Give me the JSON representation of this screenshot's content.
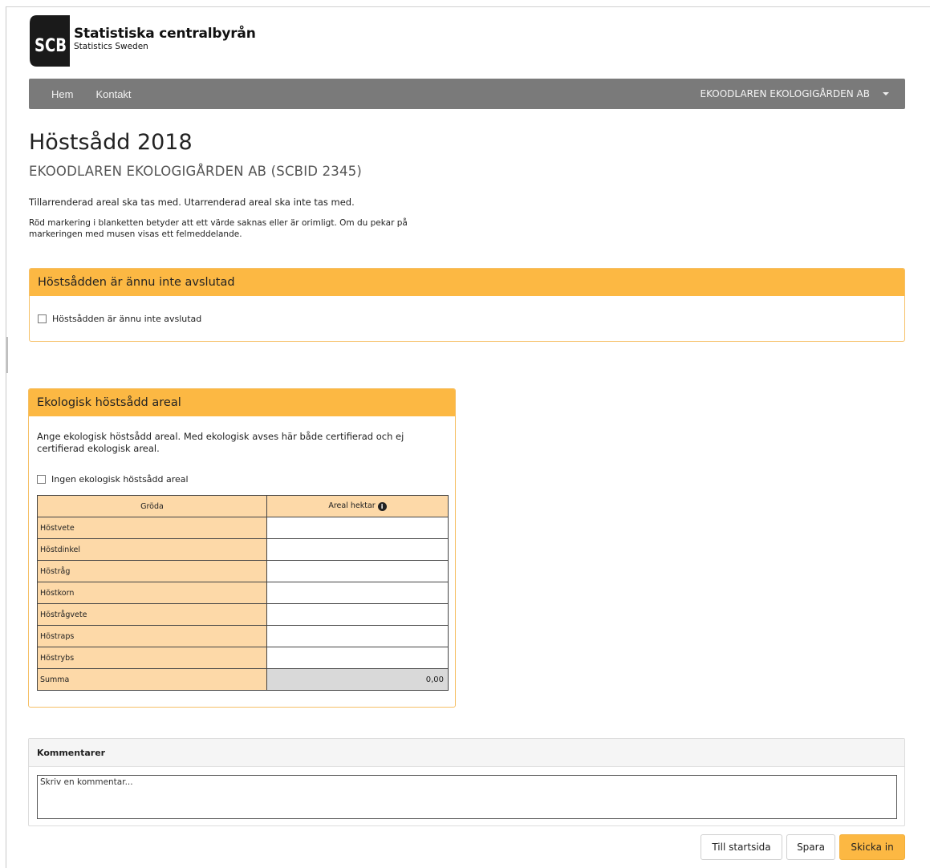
{
  "brand": {
    "mark_text": "SCB",
    "name": "Statistiska centralbyrån",
    "tagline": "Statistics Sweden"
  },
  "nav": {
    "links": [
      {
        "label": "Hem"
      },
      {
        "label": "Kontakt"
      }
    ],
    "user_menu_label": "EKOODLAREN EKOLOGIGÅRDEN AB"
  },
  "page": {
    "title": "Höstsådd 2018",
    "subtitle": "EKOODLAREN EKOLOGIGÅRDEN AB (SCBID 2345)",
    "intro_1": "Tillarrenderad areal ska tas med. Utarrenderad areal ska inte tas med.",
    "intro_2": "Röd markering i blanketten betyder att ett värde saknas eller är orimligt. Om du pekar på markeringen med musen visas ett felmeddelande."
  },
  "panel_unfinished": {
    "heading": "Höstsådden är ännu inte avslutad",
    "checkbox_label": "Höstsådden är ännu inte avslutad",
    "checked": false
  },
  "panel_organic": {
    "heading": "Ekologisk höstsådd areal",
    "description": "Ange ekologisk höstsådd areal. Med ekologisk avses här både certifierad och ej certifierad ekologisk areal.",
    "checkbox_label": "Ingen ekologisk höstsådd areal",
    "checked": false,
    "table": {
      "headers": {
        "crop": "Gröda",
        "area": "Areal hektar"
      },
      "rows": [
        {
          "crop": "Höstvete",
          "area": ""
        },
        {
          "crop": "Höstdinkel",
          "area": ""
        },
        {
          "crop": "Höstråg",
          "area": ""
        },
        {
          "crop": "Höstkorn",
          "area": ""
        },
        {
          "crop": "Höstrågvete",
          "area": ""
        },
        {
          "crop": "Höstraps",
          "area": ""
        },
        {
          "crop": "Höstrybs",
          "area": ""
        }
      ],
      "sum_label": "Summa",
      "sum_value": "0,00"
    }
  },
  "comments": {
    "heading": "Kommentarer",
    "placeholder": "Skriv en kommentar..."
  },
  "actions": {
    "home": "Till startsida",
    "save": "Spara",
    "submit": "Skicka in"
  },
  "colors": {
    "accent": "#fcb843",
    "nav_bg": "#7a7a7a",
    "table_label_bg": "#fdd9a8",
    "sum_bg": "#d9d9d9"
  }
}
